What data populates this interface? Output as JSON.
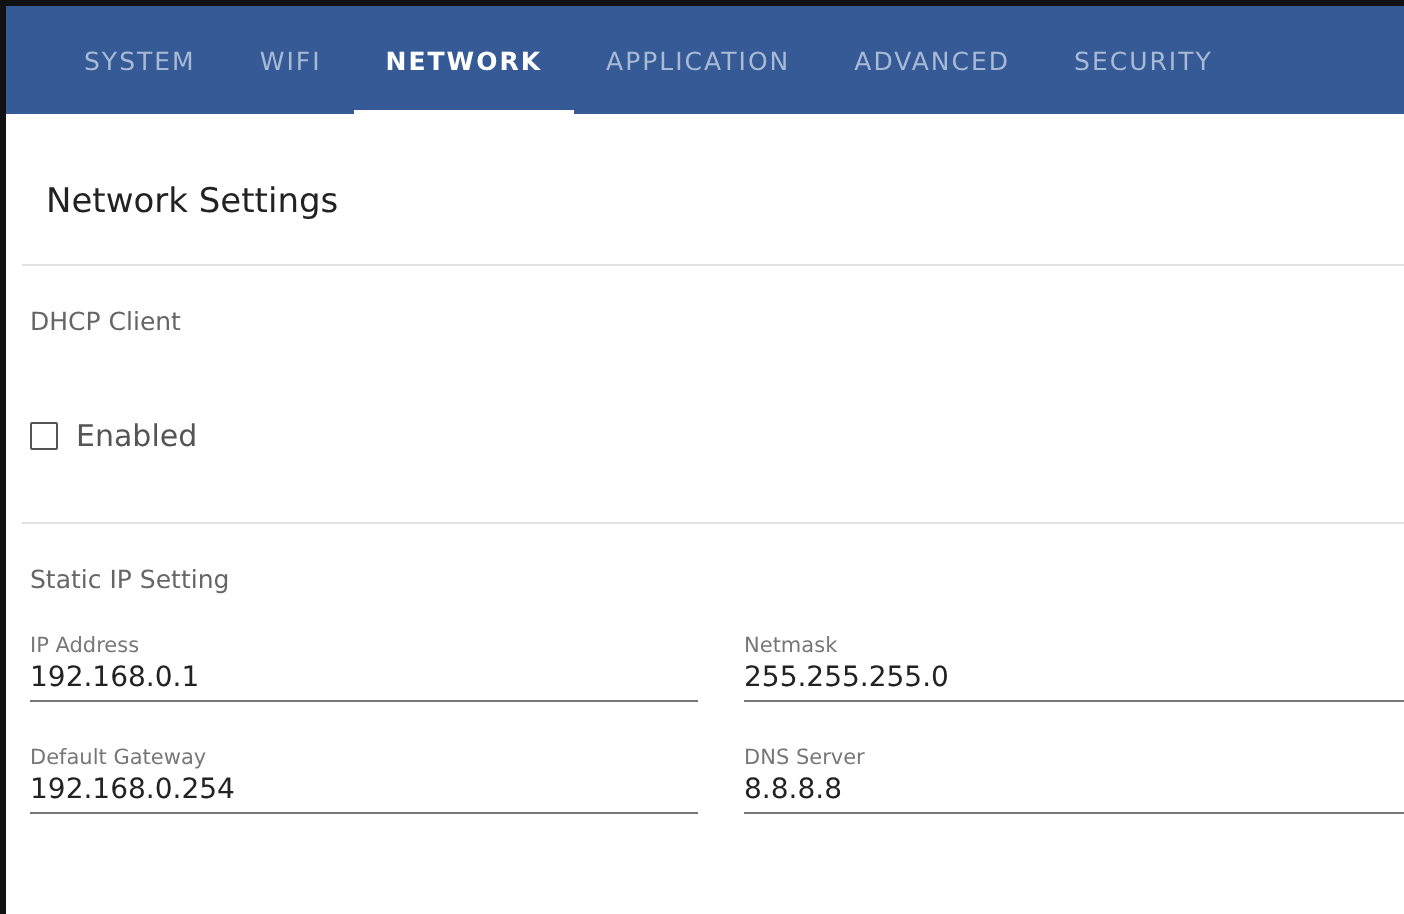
{
  "tabs": [
    {
      "label": "SYSTEM",
      "selected": false
    },
    {
      "label": "WIFI",
      "selected": false
    },
    {
      "label": "NETWORK",
      "selected": true
    },
    {
      "label": "APPLICATION",
      "selected": false
    },
    {
      "label": "ADVANCED",
      "selected": false
    },
    {
      "label": "SECURITY",
      "selected": false
    }
  ],
  "title": "Network Settings",
  "dhcp": {
    "heading": "DHCP Client",
    "checkbox": {
      "label": "Enabled",
      "checked": false
    }
  },
  "static_ip": {
    "heading": "Static IP Setting",
    "fields": [
      {
        "label": "IP Address",
        "value": "192.168.0.1"
      },
      {
        "label": "Netmask",
        "value": "255.255.255.0"
      },
      {
        "label": "Default Gateway",
        "value": "192.168.0.254"
      },
      {
        "label": "DNS Server",
        "value": "8.8.8.8"
      }
    ]
  }
}
